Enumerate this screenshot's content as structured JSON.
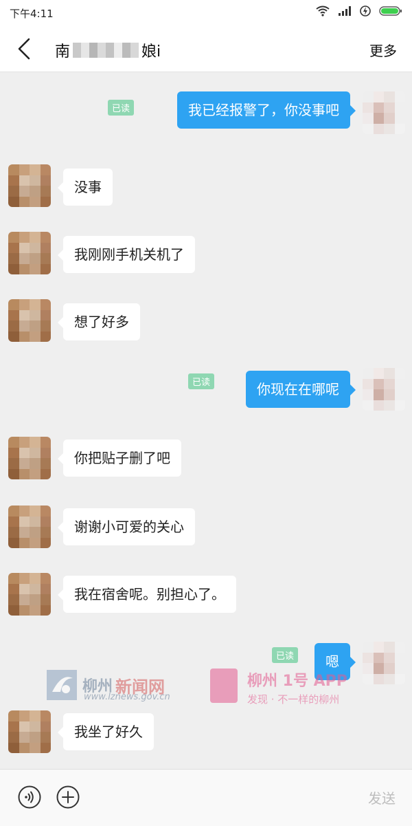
{
  "status_bar": {
    "time": "下午4:11",
    "icons": [
      "wifi-icon",
      "signal-icon",
      "charging-icon",
      "battery-icon"
    ],
    "battery_color": "#3ecf4f"
  },
  "header": {
    "title_prefix": "南",
    "title_suffix": "娘i",
    "more_label": "更多",
    "back_icon": "chevron-left-icon"
  },
  "colors": {
    "outgoing_bubble": "#2ea3f2",
    "incoming_bubble": "#ffffff",
    "read_badge": "#8fd7b2",
    "background": "#efefef"
  },
  "messages": [
    {
      "side": "out",
      "text": "我已经报警了，你没事吧",
      "read": "已读"
    },
    {
      "side": "in",
      "text": "没事"
    },
    {
      "side": "in",
      "text": "我刚刚手机关机了"
    },
    {
      "side": "in",
      "text": "想了好多"
    },
    {
      "side": "out",
      "text": "你现在在哪呢",
      "read": "已读"
    },
    {
      "side": "in",
      "text": "你把贴子删了吧"
    },
    {
      "side": "in",
      "text": "谢谢小可爱的关心"
    },
    {
      "side": "in",
      "text": "我在宿舍呢。别担心了。"
    },
    {
      "side": "out",
      "text": "嗯",
      "read": "已读"
    },
    {
      "side": "in",
      "text": "我坐了好久"
    }
  ],
  "watermark": {
    "left_name": "柳州",
    "left_name2": "新闻网",
    "left_url": "www.lznews.gov.cn",
    "right_app": "柳州 1号 APP",
    "right_slogan": "发现 · 不一样的柳州"
  },
  "input_bar": {
    "send_label": "发送",
    "voice_icon": "voice-icon",
    "plus_icon": "plus-icon"
  }
}
